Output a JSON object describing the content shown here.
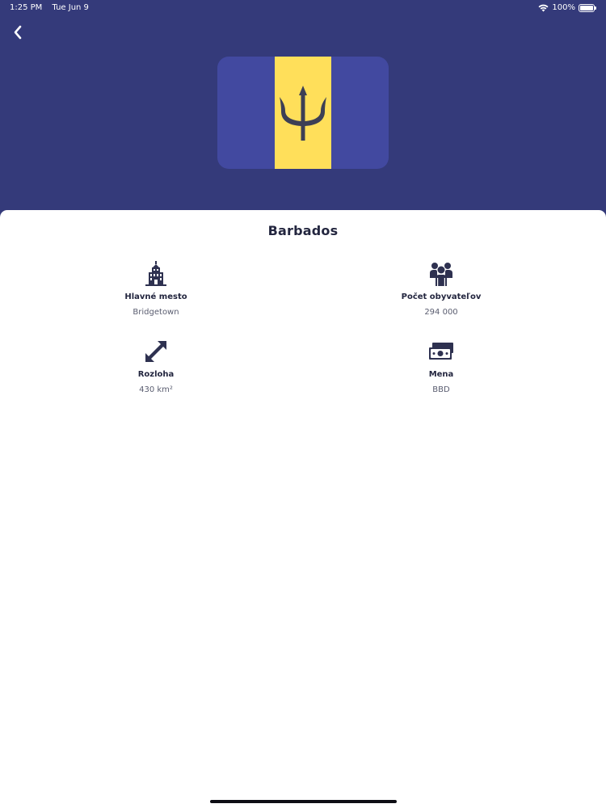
{
  "status_bar": {
    "time": "1:25 PM",
    "date": "Tue Jun 9",
    "battery": "100%",
    "battery_level": 1.0,
    "wifi_icon": "wifi-icon"
  },
  "header": {
    "back_icon": "chevron-left-icon",
    "flag": {
      "country_code": "BB",
      "colors": {
        "blue": "#4249a0",
        "gold": "#ffdf5a",
        "trident": "#3d3f55"
      }
    }
  },
  "detail": {
    "title": "Barbados",
    "items": [
      {
        "icon": "building-icon",
        "label": "Hlavné mesto",
        "value": "Bridgetown"
      },
      {
        "icon": "people-icon",
        "label": "Počet obyvateľov",
        "value": "294 000"
      },
      {
        "icon": "diagonal-arrows-icon",
        "label": "Rozloha",
        "value": "430 km²"
      },
      {
        "icon": "money-icon",
        "label": "Mena",
        "value": "BBD"
      }
    ]
  },
  "colors": {
    "header_background": "#343a7a",
    "sheet_background": "#ffffff",
    "text_primary": "#23263f",
    "text_secondary": "#5a5d70"
  }
}
